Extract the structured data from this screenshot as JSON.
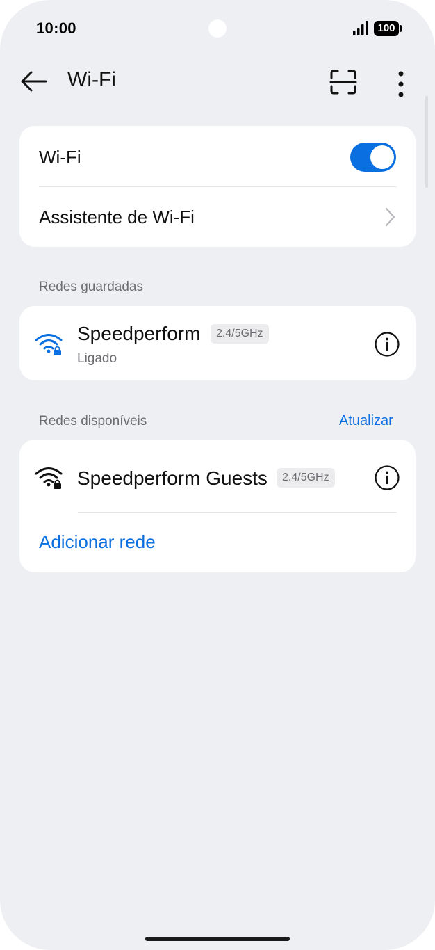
{
  "status_bar": {
    "time": "10:00",
    "battery": "100",
    "signal_icon": "signal-bars-icon"
  },
  "header": {
    "title": "Wi-Fi",
    "back_icon": "arrow-left-icon",
    "scan_icon": "scan-frame-icon",
    "more_icon": "more-vertical-icon"
  },
  "wifi_card": {
    "wifi_label": "Wi-Fi",
    "wifi_enabled": true,
    "assistant_label": "Assistente de Wi-Fi"
  },
  "saved_networks": {
    "section_label": "Redes guardadas",
    "items": [
      {
        "name": "Speedperform",
        "band": "2.4/5GHz",
        "status": "Ligado",
        "connected": true
      }
    ]
  },
  "available_networks": {
    "section_label": "Redes disponíveis",
    "refresh_label": "Atualizar",
    "items": [
      {
        "name": "Speedperform Guests",
        "band": "2.4/5GHz"
      }
    ],
    "add_network_label": "Adicionar rede"
  },
  "colors": {
    "accent": "#0a6fe0",
    "background": "#eeeff2",
    "card": "#ffffff"
  }
}
